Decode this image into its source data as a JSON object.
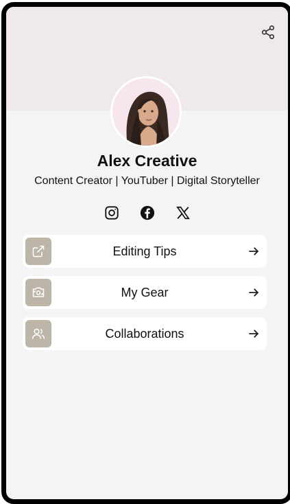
{
  "profile": {
    "name": "Alex Creative",
    "tagline": "Content Creator | YouTuber | Digital Storyteller"
  },
  "actions": {
    "share_icon": "share-icon"
  },
  "socials": [
    {
      "network": "Instagram",
      "icon": "instagram-icon"
    },
    {
      "network": "Facebook",
      "icon": "facebook-icon"
    },
    {
      "network": "X",
      "icon": "x-icon"
    }
  ],
  "links": [
    {
      "label": "Editing Tips",
      "icon": "external-link-icon"
    },
    {
      "label": "My Gear",
      "icon": "camera-rotate-icon"
    },
    {
      "label": "Collaborations",
      "icon": "users-icon"
    }
  ],
  "colors": {
    "header_band": "#efe9e9",
    "background": "#f4f4f4",
    "card": "#ffffff",
    "icon_tile": "#bdb6a8"
  }
}
